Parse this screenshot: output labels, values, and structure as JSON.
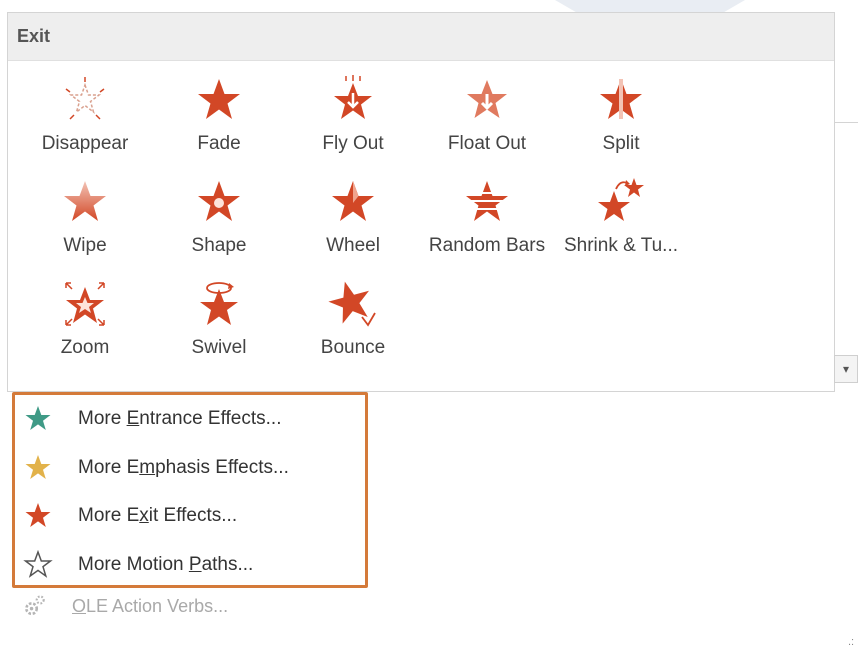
{
  "section_title": "Exit",
  "effects": [
    {
      "label": "Disappear",
      "icon": "disappear-star-icon"
    },
    {
      "label": "Fade",
      "icon": "fade-star-icon"
    },
    {
      "label": "Fly Out",
      "icon": "fly-out-star-icon"
    },
    {
      "label": "Float Out",
      "icon": "float-out-star-icon"
    },
    {
      "label": "Split",
      "icon": "split-star-icon"
    },
    {
      "label": "Wipe",
      "icon": "wipe-star-icon"
    },
    {
      "label": "Shape",
      "icon": "shape-star-icon"
    },
    {
      "label": "Wheel",
      "icon": "wheel-star-icon"
    },
    {
      "label": "Random Bars",
      "icon": "random-bars-star-icon"
    },
    {
      "label": "Shrink & Tu...",
      "icon": "shrink-turn-star-icon"
    },
    {
      "label": "Zoom",
      "icon": "zoom-star-icon"
    },
    {
      "label": "Swivel",
      "icon": "swivel-star-icon"
    },
    {
      "label": "Bounce",
      "icon": "bounce-star-icon"
    }
  ],
  "menu": {
    "entrance": {
      "pre": "More ",
      "key": "E",
      "post": "ntrance Effects..."
    },
    "emphasis": {
      "pre": "More E",
      "key": "m",
      "post": "phasis Effects..."
    },
    "exit": {
      "pre": "More E",
      "key": "x",
      "post": "it Effects..."
    },
    "motion": {
      "pre": "More Motion ",
      "key": "P",
      "post": "aths..."
    },
    "ole": {
      "pre": "",
      "key": "O",
      "post": "LE Action Verbs..."
    }
  },
  "colors": {
    "accent_exit": "#d24726",
    "entrance_star": "#3f9a86",
    "emphasis_star": "#e2b24a",
    "highlight_border": "#d47a3a",
    "disabled_text": "#a9a9a9"
  }
}
